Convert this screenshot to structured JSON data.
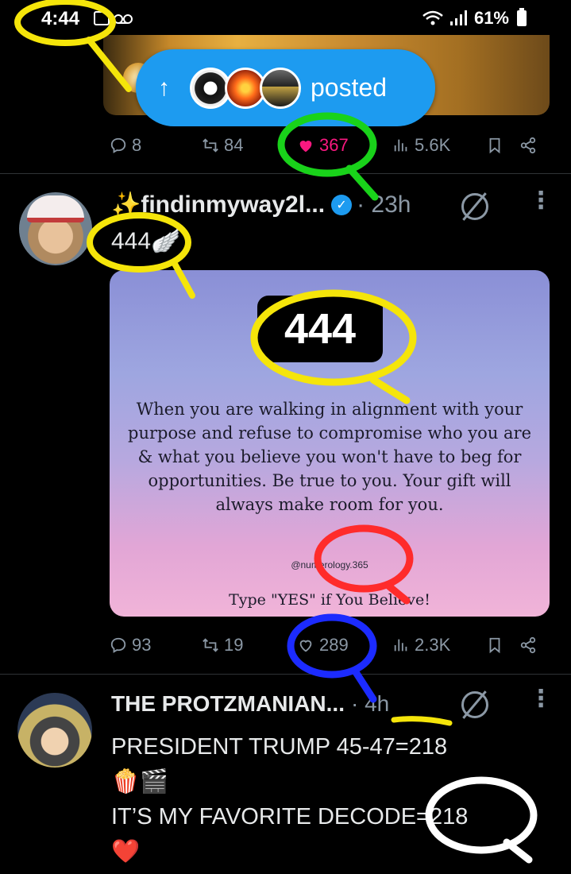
{
  "status_bar": {
    "time": "4:44",
    "battery": "61%"
  },
  "posted_pill": {
    "label": "posted"
  },
  "posts": [
    {
      "actions": {
        "replies": "8",
        "reposts": "84",
        "likes": "367",
        "views": "5.6K"
      }
    },
    {
      "display_name": "✨findinmyway2l...",
      "time": "· 23h",
      "text": "444",
      "text_emoji": "🪽",
      "card": {
        "number": "444",
        "quote": "When you are walking in alignment with your purpose and refuse to compromise who you are & what you believe you won't have to beg for opportunities. Be true to you. Your gift will always make room for you.",
        "handle": "@numerology.365",
        "cta": "Type \"YES\" if You Believe!"
      },
      "actions": {
        "replies": "93",
        "reposts": "19",
        "likes": "289",
        "views": "2.3K"
      }
    },
    {
      "display_name": "THE PROTZMANIAN...",
      "time": "· 4h",
      "line1": "PRESIDENT TRUMP 45-47=218",
      "line2": "🍿🎬",
      "line3": "IT’S MY FAVORITE DECODE=218",
      "line4": "❤️"
    }
  ],
  "colors": {
    "accent": "#1d9bf0",
    "like": "#f91880",
    "muted": "#8b98a5",
    "annot_yellow": "#f5e50a",
    "annot_green": "#19d21a",
    "annot_red": "#ff2b2b",
    "annot_blue": "#1c2bff",
    "annot_white": "#ffffff"
  }
}
